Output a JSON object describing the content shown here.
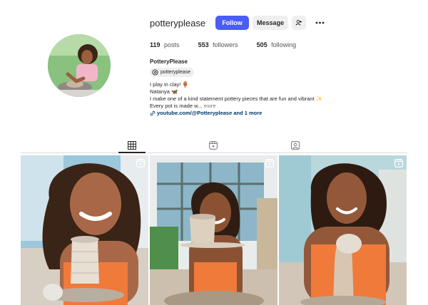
{
  "profile": {
    "username": "potteryplease",
    "follow_label": "Follow",
    "message_label": "Message",
    "stats": {
      "posts_count": "119",
      "posts_label": "posts",
      "followers_count": "553",
      "followers_label": "followers",
      "following_count": "505",
      "following_label": "following"
    },
    "full_name": "PotteryPlease",
    "threads_handle": "potteryplease",
    "bio": {
      "line1": "I play in clay! 🏺",
      "line2": "Natanya 🦋",
      "line3": "I make one of a kind statement pottery pieces that are fun and vibrant ✨",
      "line4": "Every pot is made w...",
      "more_label": "more",
      "link_text": "youtube.com/@Potteryplease and 1 more"
    }
  },
  "tabs": [
    {
      "name": "posts",
      "icon": "grid-icon",
      "active": true
    },
    {
      "name": "reels",
      "icon": "reels-icon",
      "active": false
    },
    {
      "name": "tagged",
      "icon": "tagged-icon",
      "active": false
    }
  ],
  "posts": [
    {
      "type": "reel",
      "icon": "reel-icon"
    },
    {
      "type": "reel",
      "icon": "reel-icon"
    },
    {
      "type": "reel",
      "icon": "reel-icon"
    }
  ],
  "colors": {
    "follow_button": "#4a5df9",
    "secondary_button": "#efefef",
    "link": "#00376b",
    "text": "#262626",
    "muted": "#737373"
  }
}
